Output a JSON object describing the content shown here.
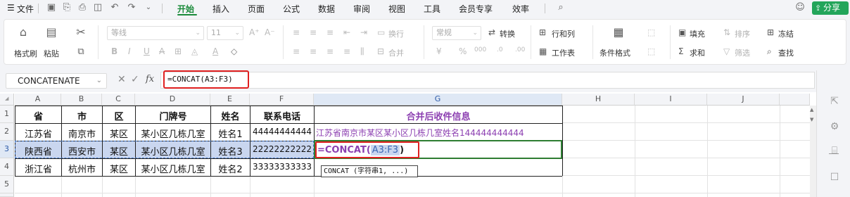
{
  "menubar": {
    "file_label": "文件",
    "tabs": [
      "开始",
      "插入",
      "页面",
      "公式",
      "数据",
      "审阅",
      "视图",
      "工具",
      "会员专享",
      "效率"
    ],
    "active_tab": "开始",
    "share_label": "分享"
  },
  "ribbon": {
    "format_painter": "格式刷",
    "paste": "粘贴",
    "font_name": "等线",
    "font_size": "11",
    "wrap_text": "换行",
    "merge": "合并",
    "number_format": "常规",
    "convert": "转换",
    "rows_cols": "行和列",
    "worksheet": "工作表",
    "cond_format": "条件格式",
    "fill": "填充",
    "sort": "排序",
    "freeze": "冻结",
    "sum": "求和",
    "filter": "筛选",
    "find": "查找"
  },
  "formula_bar": {
    "name_box": "CONCATENATE",
    "fx": "fx",
    "formula": "=CONCAT(A3:F3)"
  },
  "sheet": {
    "columns": [
      "A",
      "B",
      "C",
      "D",
      "E",
      "F",
      "G",
      "H",
      "I",
      "J"
    ],
    "rows": [
      "1",
      "2",
      "3",
      "4",
      "5"
    ],
    "header": [
      "省",
      "市",
      "区",
      "门牌号",
      "姓名",
      "联系电话",
      "合并后收件信息"
    ],
    "r2": [
      "江苏省",
      "南京市",
      "某区",
      "某小区几栋几室",
      "姓名1",
      "44444444444",
      "江苏省南京市某区某小区几栋几室姓名144444444444"
    ],
    "r3": [
      "陕西省",
      "西安市",
      "某区",
      "某小区几栋几室",
      "姓名3",
      "22222222222"
    ],
    "r4": [
      "浙江省",
      "杭州市",
      "某区",
      "某小区几栋几室",
      "姓名2",
      "33333333333"
    ],
    "editing": {
      "prefix": "=CONCAT(",
      "ref": "A3:F3",
      "suffix": ")"
    },
    "tooltip": "CONCAT (字符串1, ...)"
  }
}
